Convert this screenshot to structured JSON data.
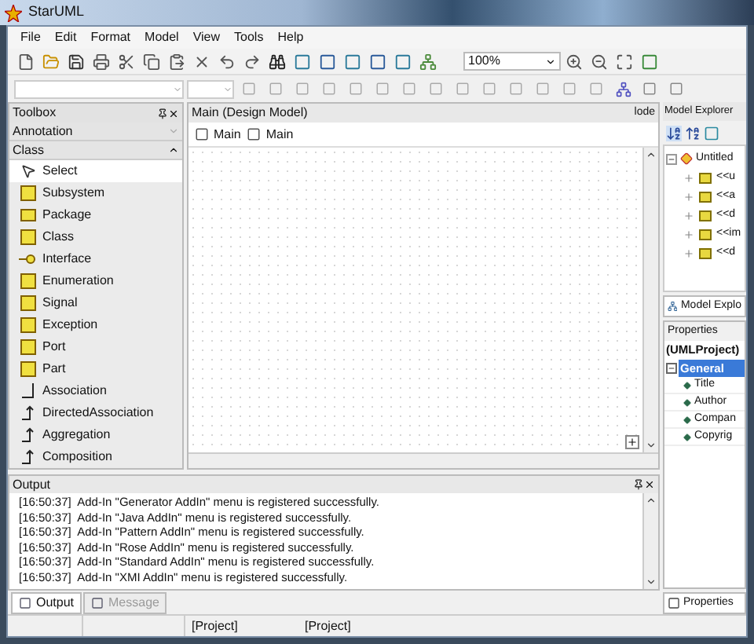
{
  "window": {
    "title": "StarUML"
  },
  "menu": [
    "File",
    "Edit",
    "Format",
    "Model",
    "View",
    "Tools",
    "Help"
  ],
  "zoom": {
    "value": "100%"
  },
  "toolbox": {
    "title": "Toolbox",
    "categories": [
      {
        "label": "Annotation",
        "expanded": false
      },
      {
        "label": "Class",
        "expanded": true
      }
    ],
    "items": [
      {
        "label": "Select",
        "kind": "pointer",
        "selected": true
      },
      {
        "label": "Subsystem",
        "kind": "box",
        "selected": false
      },
      {
        "label": "Package",
        "kind": "folder",
        "selected": false
      },
      {
        "label": "Class",
        "kind": "box",
        "selected": false
      },
      {
        "label": "Interface",
        "kind": "lollipop",
        "selected": false
      },
      {
        "label": "Enumeration",
        "kind": "box",
        "selected": false
      },
      {
        "label": "Signal",
        "kind": "box",
        "selected": false
      },
      {
        "label": "Exception",
        "kind": "box",
        "selected": false
      },
      {
        "label": "Port",
        "kind": "box",
        "selected": false
      },
      {
        "label": "Part",
        "kind": "box",
        "selected": false
      },
      {
        "label": "Association",
        "kind": "line",
        "selected": false
      },
      {
        "label": "DirectedAssociation",
        "kind": "arrow",
        "selected": false
      },
      {
        "label": "Aggregation",
        "kind": "arrow",
        "selected": false
      },
      {
        "label": "Composition",
        "kind": "arrow",
        "selected": false
      }
    ]
  },
  "diagram": {
    "title": "Main (Design Model)",
    "tabs": [
      "Main",
      "Main"
    ]
  },
  "model_explorer": {
    "cut_title": "lode",
    "title": "Model Explorer",
    "tree": [
      {
        "label": "Untitled",
        "expanded": true,
        "children": [
          {
            "label": "<<u",
            "expanded": false
          },
          {
            "label": "<<a",
            "expanded": false
          },
          {
            "label": "<<d",
            "expanded": false
          },
          {
            "label": "<<im",
            "expanded": false
          },
          {
            "label": "<<d",
            "expanded": false
          }
        ]
      }
    ],
    "tab": "Model Explo"
  },
  "properties": {
    "title": "Properties",
    "object": "(UMLProject)",
    "group": {
      "label": "General",
      "selected": true,
      "expanded": true,
      "items": [
        "Title",
        "Author",
        "Compan",
        "Copyrig"
      ]
    },
    "tab": "Properties"
  },
  "output": {
    "title": "Output",
    "lines": [
      "[16:50:37]  Add-In \"Generator AddIn\" menu is registered successfully.",
      "[16:50:37]  Add-In \"Java AddIn\" menu is registered successfully.",
      "[16:50:37]  Add-In \"Pattern AddIn\" menu is registered successfully.",
      "[16:50:37]  Add-In \"Rose AddIn\" menu is registered successfully.",
      "[16:50:37]  Add-In \"Standard AddIn\" menu is registered successfully.",
      "[16:50:37]  Add-In \"XMI AddIn\" menu is registered successfully."
    ]
  },
  "bottom_tabs": [
    {
      "label": "Output",
      "selected": true,
      "disabled": false
    },
    {
      "label": "Message",
      "selected": false,
      "disabled": true
    }
  ],
  "status_bar": [
    "[Project]",
    "[Project]"
  ]
}
